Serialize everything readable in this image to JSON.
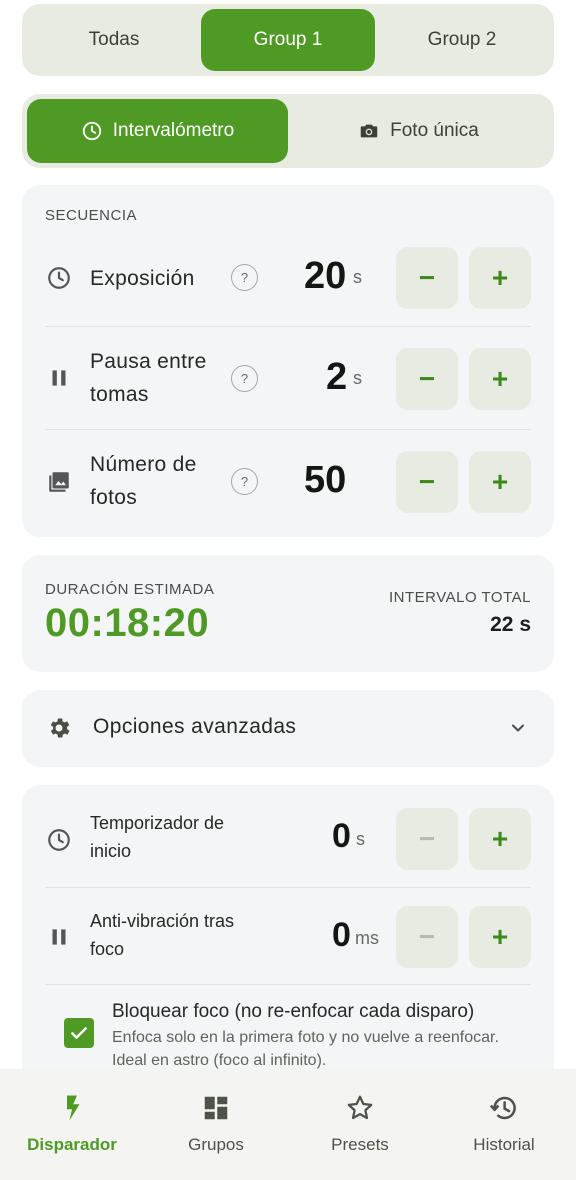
{
  "group_tabs": [
    {
      "label": "Todas",
      "active": false
    },
    {
      "label": "Group 1",
      "active": true
    },
    {
      "label": "Group 2",
      "active": false
    }
  ],
  "mode_tabs": [
    {
      "label": "Intervalómetro",
      "icon": "clock-icon",
      "active": true
    },
    {
      "label": "Foto única",
      "icon": "camera-icon",
      "active": false
    }
  ],
  "sequence": {
    "title": "SECUENCIA",
    "rows": [
      {
        "label": "Exposición",
        "icon": "clock-icon",
        "help": "?",
        "value": "20",
        "unit": "s",
        "minus": "−",
        "plus": "+"
      },
      {
        "label": "Pausa entre tomas",
        "icon": "pause-icon",
        "help": "?",
        "value": "2",
        "unit": "s",
        "minus": "−",
        "plus": "+"
      },
      {
        "label": "Número de fotos",
        "icon": "photo-library-icon",
        "help": "?",
        "value": "50",
        "unit": "",
        "minus": "−",
        "plus": "+"
      }
    ]
  },
  "duration": {
    "label": "DURACIÓN ESTIMADA",
    "value": "00:18:20",
    "interval_label": "INTERVALO TOTAL",
    "interval_value": "22 s"
  },
  "advanced": {
    "label": "Opciones avanzadas",
    "icon": "gear-icon",
    "chevron": "chevron-down-icon"
  },
  "options": {
    "rows": [
      {
        "label": "Temporizador de inicio",
        "icon": "clock-icon",
        "value": "0",
        "unit": "s",
        "minus": "−",
        "plus": "+",
        "minus_disabled": true
      },
      {
        "label": "Anti-vibración tras foco",
        "icon": "pause-icon",
        "value": "0",
        "unit": "ms",
        "minus": "−",
        "plus": "+",
        "minus_disabled": true
      }
    ],
    "lock_focus": {
      "checked": true,
      "title": "Bloquear foco (no re-enfocar cada disparo)",
      "description": "Enfoca solo en la primera foto y no vuelve a reenfocar. Ideal en astro (foco al infinito)."
    }
  },
  "bottom_nav": [
    {
      "label": "Disparador",
      "icon": "bolt-icon",
      "active": true
    },
    {
      "label": "Grupos",
      "icon": "dashboard-icon",
      "active": false
    },
    {
      "label": "Presets",
      "icon": "star-icon",
      "active": false
    },
    {
      "label": "Historial",
      "icon": "history-icon",
      "active": false
    }
  ],
  "colors": {
    "accent": "#4f9a24",
    "segment_bg": "#e8ebe2",
    "card_bg": "#f4f5f7"
  }
}
